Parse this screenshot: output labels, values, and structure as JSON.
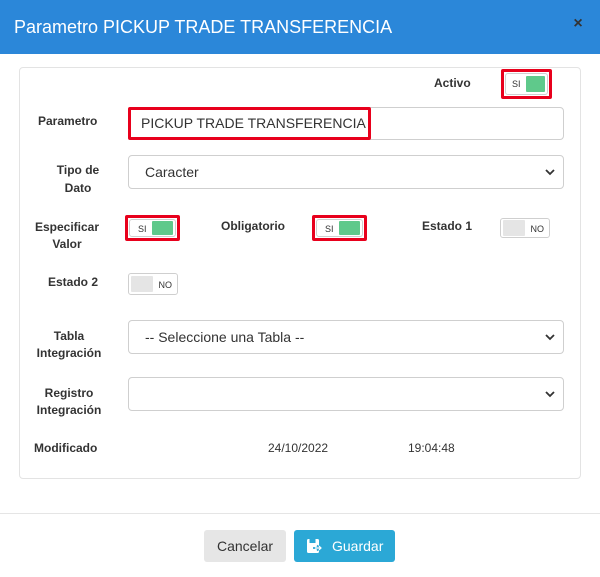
{
  "header": {
    "title": "Parametro PICKUP TRADE TRANSFERENCIA",
    "close_icon": "×"
  },
  "form": {
    "activo": {
      "label": "Activo",
      "toggle_text": "SI",
      "state": "on"
    },
    "parametro": {
      "label": "Parametro",
      "value": "PICKUP TRADE TRANSFERENCIA"
    },
    "tipo_dato": {
      "label_line1": "Tipo de",
      "label_line2": "Dato",
      "value": "Caracter"
    },
    "especificar_valor": {
      "label_line1": "Especificar",
      "label_line2": "Valor",
      "toggle_text": "SI",
      "state": "on"
    },
    "obligatorio": {
      "label": "Obligatorio",
      "toggle_text": "SI",
      "state": "on"
    },
    "estado1": {
      "label": "Estado 1",
      "toggle_text": "NO",
      "state": "off"
    },
    "estado2": {
      "label": "Estado 2",
      "toggle_text": "NO",
      "state": "off"
    },
    "tabla_integracion": {
      "label_line1": "Tabla",
      "label_line2": "Integración",
      "value": "-- Seleccione una Tabla --"
    },
    "registro_integracion": {
      "label_line1": "Registro",
      "label_line2": "Integración",
      "value": ""
    },
    "modificado": {
      "label": "Modificado",
      "date": "24/10/2022",
      "time": "19:04:48"
    }
  },
  "footer": {
    "cancel_label": "Cancelar",
    "save_label": "Guardar"
  },
  "colors": {
    "header_bg": "#2b87d9",
    "toggle_on": "#5fc98b",
    "highlight": "#e8001c",
    "save_button": "#2ba8d6"
  }
}
